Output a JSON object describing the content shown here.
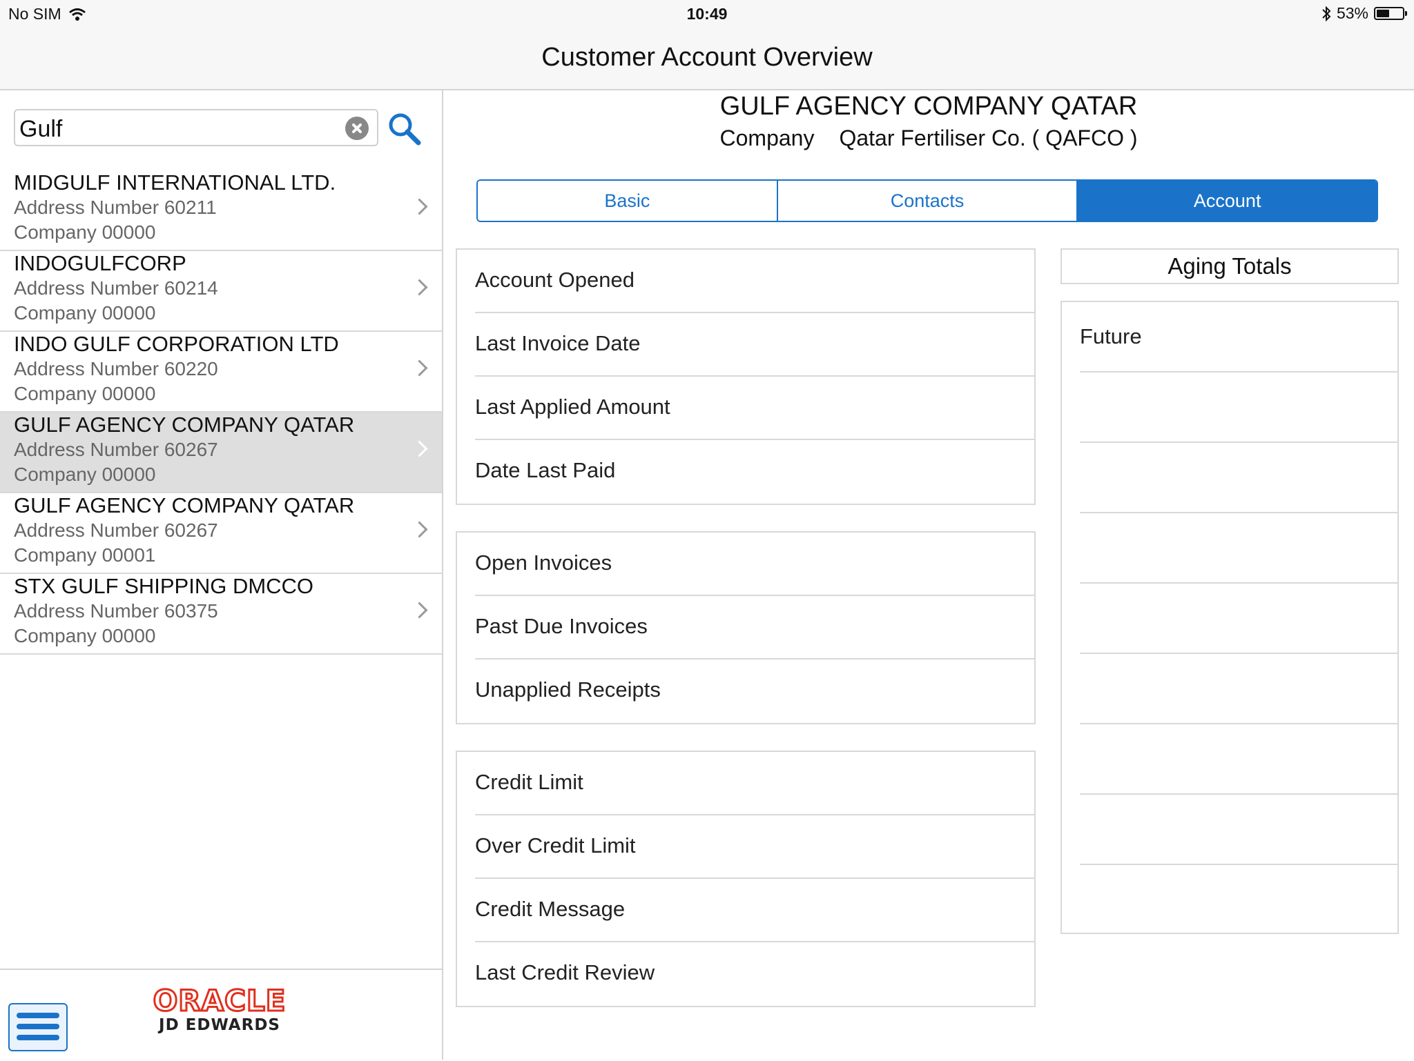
{
  "status_bar": {
    "carrier": "No SIM",
    "time": "10:49",
    "battery_percent": "53%",
    "battery_level": 0.53
  },
  "nav": {
    "title": "Customer Account Overview"
  },
  "search": {
    "value": "Gulf"
  },
  "results": [
    {
      "name": "MIDGULF INTERNATIONAL LTD.",
      "address": "Address Number 60211",
      "company": "Company 00000",
      "selected": false
    },
    {
      "name": "INDOGULFCORP",
      "address": "Address Number 60214",
      "company": "Company 00000",
      "selected": false
    },
    {
      "name": "INDO GULF CORPORATION LTD",
      "address": "Address Number 60220",
      "company": "Company 00000",
      "selected": false
    },
    {
      "name": "GULF AGENCY COMPANY QATAR",
      "address": "Address Number 60267",
      "company": "Company 00000",
      "selected": true
    },
    {
      "name": "GULF AGENCY COMPANY QATAR",
      "address": "Address Number 60267",
      "company": "Company 00001",
      "selected": false
    },
    {
      "name": "STX GULF SHIPPING DMCCO",
      "address": "Address Number 60375",
      "company": "Company 00000",
      "selected": false
    }
  ],
  "footer": {
    "logo_top": "ORACLE",
    "logo_bottom": "JD EDWARDS"
  },
  "detail": {
    "title": "GULF AGENCY COMPANY QATAR",
    "company_label": "Company",
    "company_value": "Qatar Fertiliser Co. ( QAFCO )"
  },
  "tabs": [
    {
      "label": "Basic",
      "active": false
    },
    {
      "label": "Contacts",
      "active": false
    },
    {
      "label": "Account",
      "active": true
    }
  ],
  "account_groups": [
    [
      "Account Opened",
      "Last Invoice Date",
      "Last Applied Amount",
      "Date Last Paid"
    ],
    [
      "Open Invoices",
      "Past Due Invoices",
      "Unapplied Receipts"
    ],
    [
      "Credit Limit",
      "Over Credit Limit",
      "Credit Message",
      "Last Credit Review"
    ]
  ],
  "aging": {
    "title": "Aging Totals",
    "rows": [
      "Future",
      "",
      "",
      "",
      "",
      "",
      "",
      "",
      ""
    ]
  },
  "colors": {
    "accent": "#1a73c9",
    "oracle_red": "#e0301e",
    "selected_row": "#dedede"
  }
}
